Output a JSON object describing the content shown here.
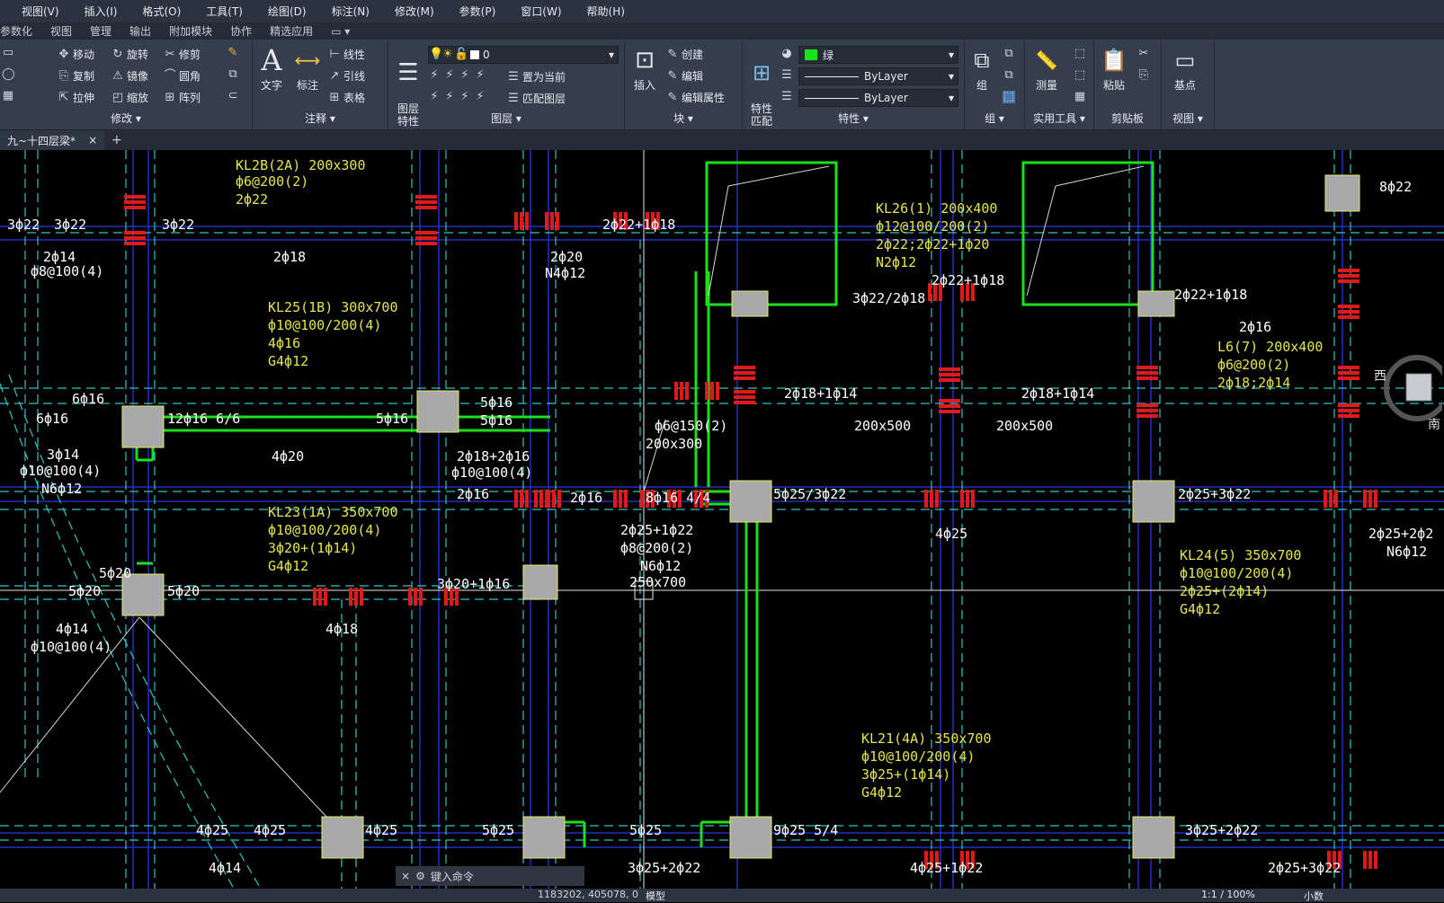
{
  "menu": [
    "视图(V)",
    "插入(I)",
    "格式(O)",
    "工具(T)",
    "绘图(D)",
    "标注(N)",
    "修改(M)",
    "参数(P)",
    "窗口(W)",
    "帮助(H)"
  ],
  "ribbon_tabs": [
    "参数化",
    "视图",
    "管理",
    "输出",
    "附加模块",
    "协作",
    "精选应用"
  ],
  "ribbon": {
    "modify": {
      "label": "修改 ▾",
      "move": "移动",
      "rotate": "旋转",
      "trim": "修剪",
      "copy": "复制",
      "mirror": "镜像",
      "fillet": "圆角",
      "stretch": "拉伸",
      "scale": "缩放",
      "array": "阵列"
    },
    "annotation": {
      "label": "注释 ▾",
      "text": "文字",
      "dim": "标注",
      "linetype": "线性",
      "leader": "引线",
      "table": "表格"
    },
    "layers": {
      "label": "图层 ▾",
      "props": "图层\n特性",
      "layer_value": "0",
      "set_current": "置为当前",
      "match": "匹配图层"
    },
    "block": {
      "label": "块 ▾",
      "insert": "插入",
      "create": "创建",
      "edit": "编辑",
      "edit_attr": "编辑属性"
    },
    "properties": {
      "label": "特性 ▾",
      "match": "特性\n匹配",
      "color_value": "绿",
      "linetype_value": "ByLayer",
      "lineweight_value": "ByLayer"
    },
    "groups": {
      "label": "组 ▾",
      "group": "组"
    },
    "utilities": {
      "label": "实用工具 ▾",
      "measure": "测量"
    },
    "clipboard": {
      "label": "剪贴板",
      "paste": "粘贴"
    },
    "view": {
      "label": "视图 ▾",
      "base": "基点"
    }
  },
  "doc_tab": {
    "name": "九~十四层梁*",
    "close": "×",
    "add": "+"
  },
  "viewcube": {
    "west": "西",
    "south": "南"
  },
  "cmd": {
    "placeholder": "键入命令"
  },
  "status": {
    "coords": "1183202, 405078, 0",
    "model": "模型",
    "scale": "1:1 / 100%",
    "unit": "小数"
  },
  "labels": [
    {
      "t": "KL2B(2A) 200x300",
      "y": 1
    },
    {
      "t": "ф6@200(2)",
      "y": 1
    },
    {
      "t": "2ф22",
      "y": 1
    },
    {
      "t": "3ф22",
      "y": 0
    },
    {
      "t": "3ф22",
      "y": 0
    },
    {
      "t": "3ф22",
      "y": 0
    },
    {
      "t": "2ф14",
      "y": 0
    },
    {
      "t": "ф8@100(4)",
      "y": 0
    },
    {
      "t": "2ф18",
      "y": 0
    },
    {
      "t": "KL25(1B) 300x700",
      "y": 1
    },
    {
      "t": "ф10@100/200(4)",
      "y": 1
    },
    {
      "t": "4ф16",
      "y": 1
    },
    {
      "t": "G4ф12",
      "y": 1
    },
    {
      "t": "2ф22+1ф18",
      "y": 0
    },
    {
      "t": "2ф20",
      "y": 0
    },
    {
      "t": "N4ф12",
      "y": 0
    },
    {
      "t": "KL26(1) 200x400",
      "y": 1
    },
    {
      "t": "ф12@100/200(2)",
      "y": 1
    },
    {
      "t": "2ф22;2ф22+1ф20",
      "y": 1
    },
    {
      "t": "N2ф12",
      "y": 1
    },
    {
      "t": "2ф22+1ф18",
      "y": 0
    },
    {
      "t": "3ф22/2ф18",
      "y": 0
    },
    {
      "t": "2ф22+1ф18",
      "y": 0
    },
    {
      "t": "8ф22",
      "y": 0
    },
    {
      "t": "2ф16",
      "y": 0
    },
    {
      "t": "L6(7) 200x400",
      "y": 1
    },
    {
      "t": "ф6@200(2)",
      "y": 1
    },
    {
      "t": "2ф18;2ф14",
      "y": 1
    },
    {
      "t": "6ф16",
      "y": 0
    },
    {
      "t": "6ф16",
      "y": 0
    },
    {
      "t": "12ф16 6/6",
      "y": 0
    },
    {
      "t": "5ф16",
      "y": 0
    },
    {
      "t": "5ф16",
      "y": 0
    },
    {
      "t": "5ф16",
      "y": 0
    },
    {
      "t": "3ф14",
      "y": 0
    },
    {
      "t": "ф10@100(4)",
      "y": 0
    },
    {
      "t": "N6ф12",
      "y": 0
    },
    {
      "t": "4ф20",
      "y": 0
    },
    {
      "t": "2ф18+2ф16",
      "y": 0
    },
    {
      "t": "ф10@100(4)",
      "y": 0
    },
    {
      "t": "2ф16",
      "y": 0
    },
    {
      "t": "2ф16",
      "y": 0
    },
    {
      "t": "ф6@150(2)",
      "y": 0
    },
    {
      "t": "200x300",
      "y": 0
    },
    {
      "t": "2ф18+1ф14",
      "y": 0
    },
    {
      "t": "2ф18+1ф14",
      "y": 0
    },
    {
      "t": "200x500",
      "y": 0
    },
    {
      "t": "200x500",
      "y": 0
    },
    {
      "t": "8ф16 4/4",
      "y": 0
    },
    {
      "t": "5ф25/3ф22",
      "y": 0
    },
    {
      "t": "2ф25+3ф22",
      "y": 0
    },
    {
      "t": "4ф25",
      "y": 0
    },
    {
      "t": "KL23(1A) 350x700",
      "y": 1
    },
    {
      "t": "ф10@100/200(4)",
      "y": 1
    },
    {
      "t": "3ф20+(1ф14)",
      "y": 1
    },
    {
      "t": "G4ф12",
      "y": 1
    },
    {
      "t": "2ф25+1ф22",
      "y": 0
    },
    {
      "t": "ф8@200(2)",
      "y": 0
    },
    {
      "t": "N6ф12",
      "y": 0
    },
    {
      "t": "250x700",
      "y": 0
    },
    {
      "t": "KL24(5) 350x700",
      "y": 1
    },
    {
      "t": "ф10@100/200(4)",
      "y": 1
    },
    {
      "t": "2ф25+(2ф14)",
      "y": 1
    },
    {
      "t": "G4ф12",
      "y": 1
    },
    {
      "t": "2ф25+2ф2",
      "y": 0
    },
    {
      "t": "N6ф12",
      "y": 0
    },
    {
      "t": "5ф20",
      "y": 0
    },
    {
      "t": "5ф20",
      "y": 0
    },
    {
      "t": "5ф20",
      "y": 0
    },
    {
      "t": "3ф20+1ф16",
      "y": 0
    },
    {
      "t": "4ф14",
      "y": 0
    },
    {
      "t": "ф10@100(4)",
      "y": 0
    },
    {
      "t": "4ф18",
      "y": 0
    },
    {
      "t": "KL21(4A) 350x700",
      "y": 1
    },
    {
      "t": "ф10@100/200(4)",
      "y": 1
    },
    {
      "t": "3ф25+(1ф14)",
      "y": 1
    },
    {
      "t": "G4ф12",
      "y": 1
    },
    {
      "t": "4ф25",
      "y": 0
    },
    {
      "t": "4ф25",
      "y": 0
    },
    {
      "t": "4ф25",
      "y": 0
    },
    {
      "t": "5ф25",
      "y": 0
    },
    {
      "t": "5ф25",
      "y": 0
    },
    {
      "t": "9ф25 5/4",
      "y": 0
    },
    {
      "t": "3ф25+2ф22",
      "y": 0
    },
    {
      "t": "4ф14",
      "y": 0
    },
    {
      "t": "3ф25+2ф22",
      "y": 0
    },
    {
      "t": "4ф25+1ф22",
      "y": 0
    },
    {
      "t": "2ф25+3ф22",
      "y": 0
    }
  ]
}
